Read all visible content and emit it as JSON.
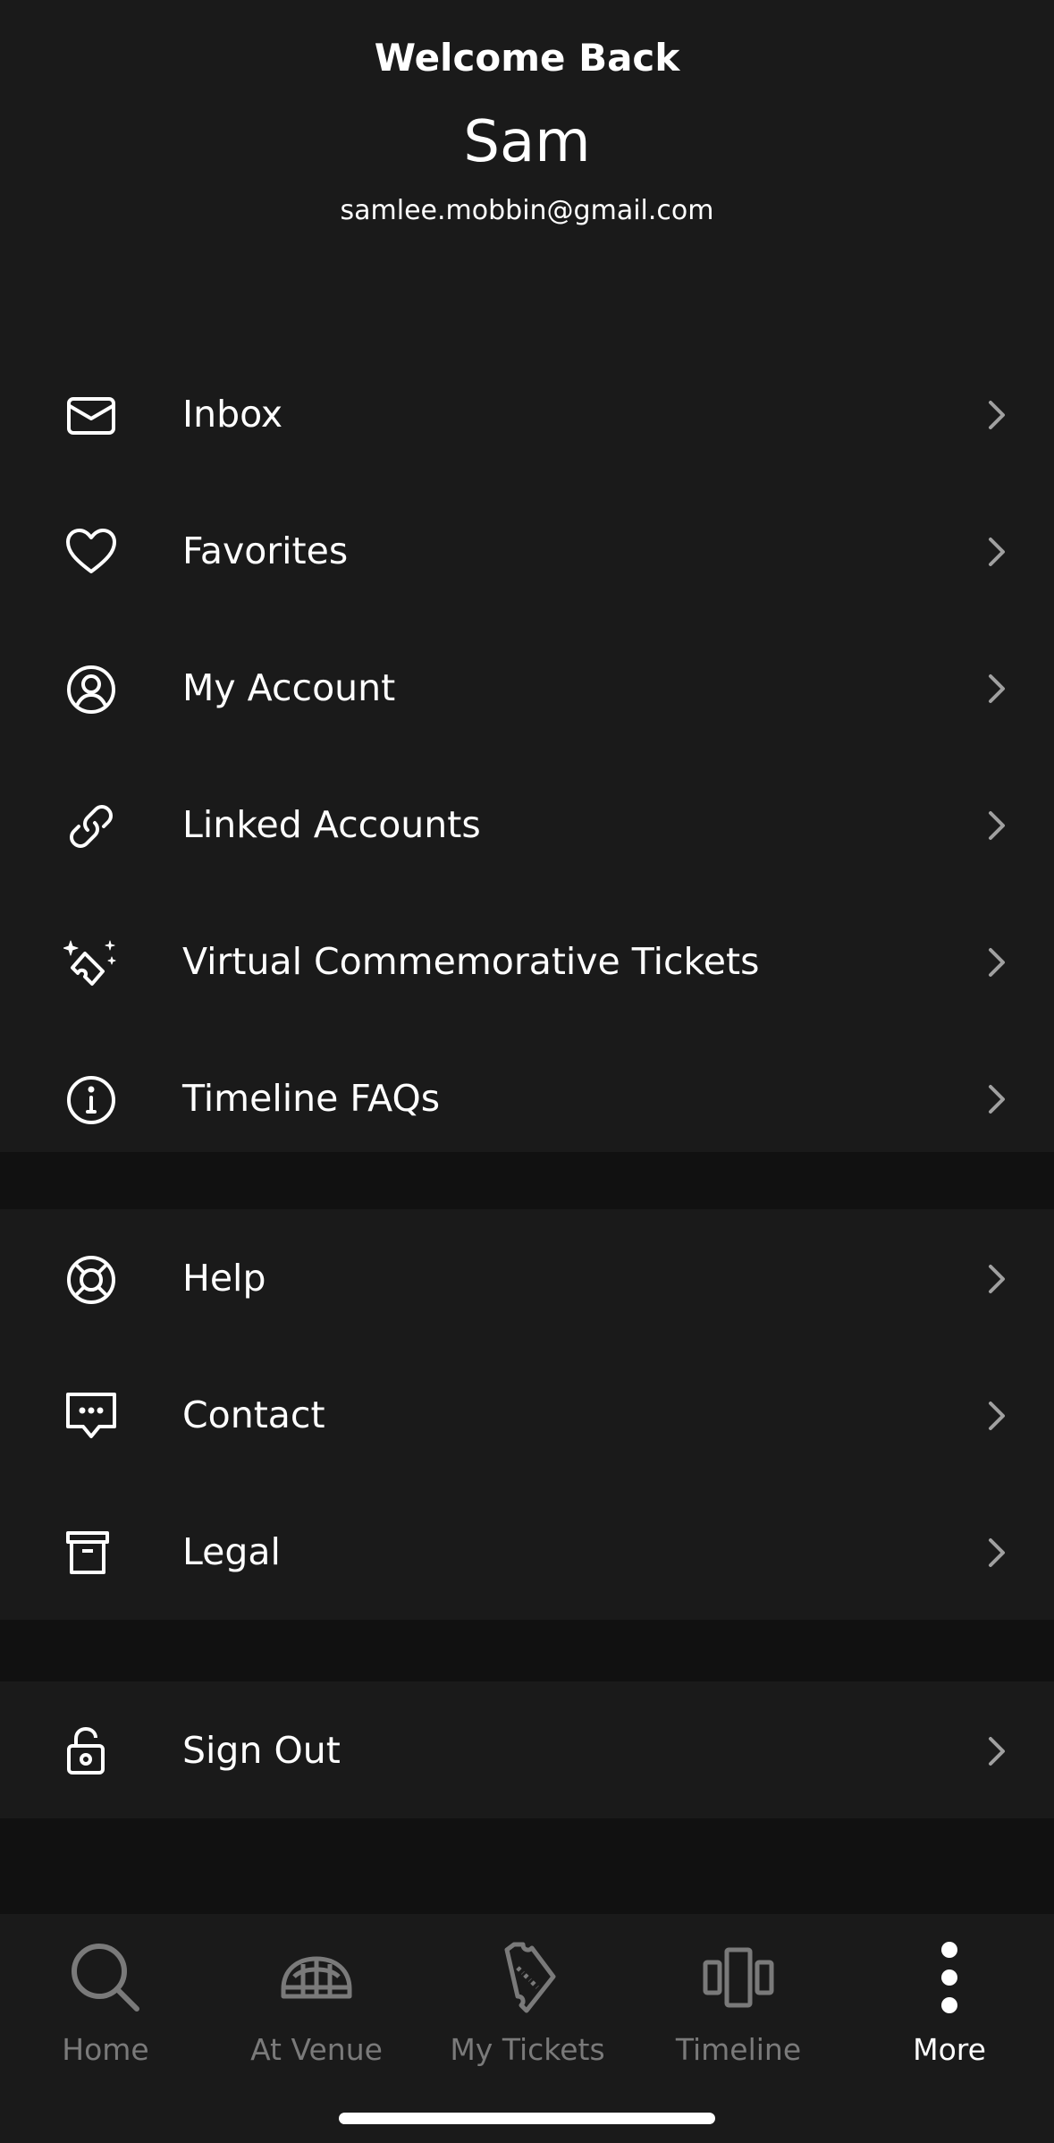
{
  "header": {
    "welcome": "Welcome Back",
    "name": "Sam",
    "email": "samlee.mobbin@gmail.com"
  },
  "menu": {
    "primary": [
      {
        "label": "Inbox",
        "icon": "envelope-icon"
      },
      {
        "label": "Favorites",
        "icon": "heart-icon"
      },
      {
        "label": "My Account",
        "icon": "user-circle-icon"
      },
      {
        "label": "Linked Accounts",
        "icon": "link-icon"
      },
      {
        "label": "Virtual Commemorative Tickets",
        "icon": "sparkle-ticket-icon"
      },
      {
        "label": "Timeline FAQs",
        "icon": "info-icon"
      }
    ],
    "support": [
      {
        "label": "Help",
        "icon": "lifebuoy-icon"
      },
      {
        "label": "Contact",
        "icon": "chat-bubble-icon"
      },
      {
        "label": "Legal",
        "icon": "archive-box-icon"
      }
    ],
    "account": [
      {
        "label": "Sign Out",
        "icon": "unlock-icon"
      }
    ]
  },
  "tabbar": {
    "items": [
      {
        "label": "Home",
        "icon": "search-icon",
        "active": false
      },
      {
        "label": "At Venue",
        "icon": "stadium-icon",
        "active": false
      },
      {
        "label": "My Tickets",
        "icon": "ticket-icon",
        "active": false
      },
      {
        "label": "Timeline",
        "icon": "timeline-icon",
        "active": false
      },
      {
        "label": "More",
        "icon": "more-vertical-icon",
        "active": true
      }
    ]
  },
  "colors": {
    "background": "#111111",
    "surface": "#1a1a1a",
    "text": "#ffffff",
    "muted": "#7a7a7a",
    "chevron": "#a0a0a0"
  }
}
